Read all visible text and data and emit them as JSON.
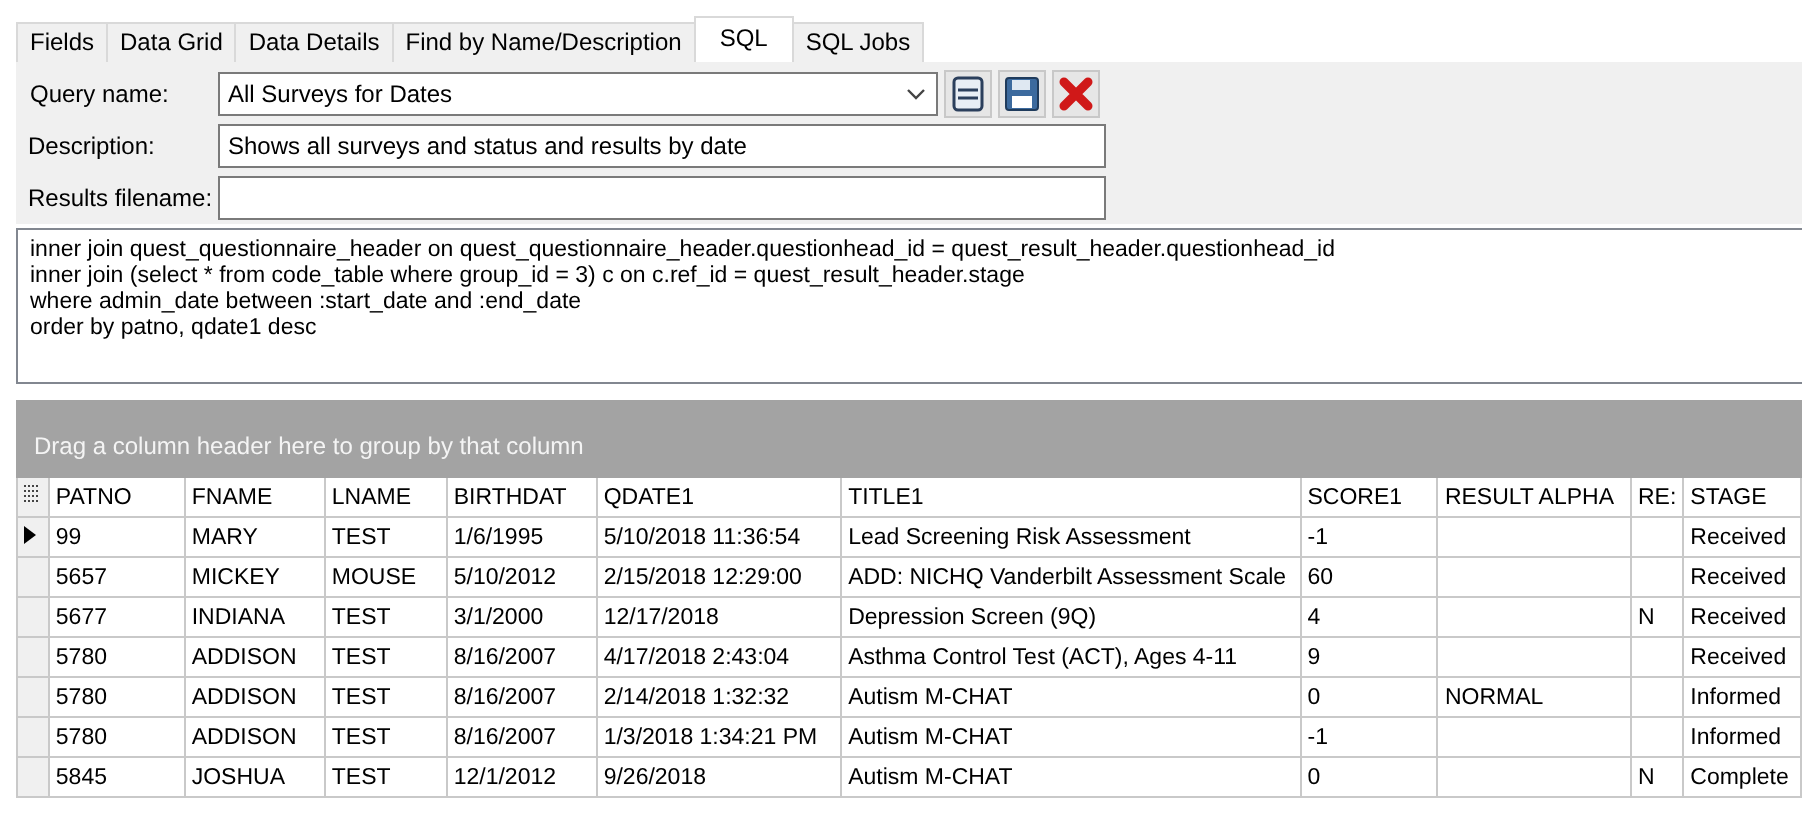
{
  "tabs": [
    {
      "label": "Fields",
      "selected": false
    },
    {
      "label": "Data Grid",
      "selected": false
    },
    {
      "label": "Data Details",
      "selected": false
    },
    {
      "label": "Find by Name/Description",
      "selected": false
    },
    {
      "label": "SQL",
      "selected": true
    },
    {
      "label": "SQL Jobs",
      "selected": false
    }
  ],
  "form": {
    "query_name": {
      "label": "Query name:",
      "value": "All Surveys for Dates"
    },
    "description": {
      "label": "Description:",
      "value": "Shows all surveys and status and results by date"
    },
    "results_filename": {
      "label": "Results filename:"
    }
  },
  "sql_lines": [
    "inner join quest_questionnaire_header on quest_questionnaire_header.questionhead_id =  quest_result_header.questionhead_id",
    "inner join (select * from code_table where group_id = 3) c on c.ref_id = quest_result_header.stage",
    "where admin_date  between :start_date and :end_date",
    "order by patno, qdate1 desc"
  ],
  "group_panel": {
    "text": "Drag a column header here to group by that column"
  },
  "table": {
    "columns": [
      "PATNO",
      "FNAME",
      "LNAME",
      "BIRTHDAT",
      "QDATE1",
      "TITLE1",
      "SCORE1",
      "RESULT ALPHA",
      "RE:",
      "STAGE"
    ],
    "rows": [
      {
        "selected": true,
        "cells": [
          "99",
          "MARY",
          "TEST",
          "1/6/1995",
          "5/10/2018 11:36:54",
          "Lead Screening Risk Assessment",
          "-1",
          "",
          "",
          "Received"
        ]
      },
      {
        "selected": false,
        "cells": [
          "5657",
          "MICKEY",
          "MOUSE",
          "5/10/2012",
          "2/15/2018 12:29:00",
          "ADD: NICHQ Vanderbilt Assessment Scale",
          "60",
          "",
          "",
          "Received"
        ]
      },
      {
        "selected": false,
        "cells": [
          "5677",
          "INDIANA",
          "TEST",
          "3/1/2000",
          "12/17/2018",
          "Depression Screen (9Q)",
          "4",
          "",
          "N",
          "Received"
        ]
      },
      {
        "selected": false,
        "cells": [
          "5780",
          "ADDISON",
          "TEST",
          "8/16/2007",
          "4/17/2018 2:43:04",
          "Asthma Control Test (ACT), Ages 4-11",
          "9",
          "",
          "",
          "Received"
        ]
      },
      {
        "selected": false,
        "cells": [
          "5780",
          "ADDISON",
          "TEST",
          "8/16/2007",
          "2/14/2018 1:32:32",
          "Autism M-CHAT",
          "0",
          "NORMAL",
          "",
          "Informed"
        ]
      },
      {
        "selected": false,
        "cells": [
          "5780",
          "ADDISON",
          "TEST",
          "8/16/2007",
          "1/3/2018 1:34:21 PM",
          "Autism M-CHAT",
          "-1",
          "",
          "",
          "Informed"
        ]
      },
      {
        "selected": false,
        "cells": [
          "5845",
          "JOSHUA",
          "TEST",
          "12/1/2012",
          "9/26/2018",
          "Autism M-CHAT",
          "0",
          "",
          "N",
          "Complete"
        ]
      }
    ]
  }
}
